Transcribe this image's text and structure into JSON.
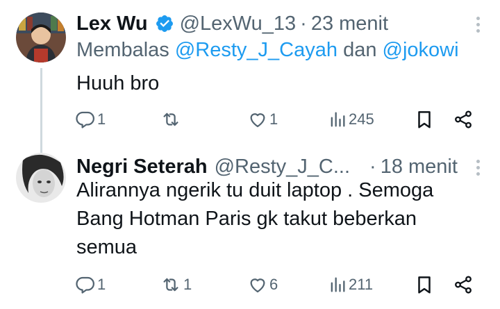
{
  "tweets": [
    {
      "name": "Lex Wu",
      "handle": "@LexWu_13",
      "time": "23 menit",
      "reply_prefix": "Membalas",
      "reply_user1": "@Resty_J_Cayah",
      "reply_joiner": "dan",
      "reply_user2": "@jokowi",
      "text": "Huuh bro",
      "replies": "1",
      "retweets": "",
      "likes": "1",
      "views": "245"
    },
    {
      "name": "Negri Seterah",
      "handle": "@Resty_J_C...",
      "time": "18 menit",
      "text": "Alirannya ngerik tu duit laptop  . Semoga Bang Hotman Paris  gk takut beberkan semua",
      "replies": "1",
      "retweets": "1",
      "likes": "6",
      "views": "211"
    }
  ],
  "icons": {
    "reply": "reply-icon",
    "retweet": "retweet-icon",
    "like": "heart-icon",
    "views": "views-icon",
    "bookmark": "bookmark-icon",
    "share": "share-icon",
    "verified": "verified-badge-icon",
    "more": "more-options-icon"
  },
  "colors": {
    "verified": "#1d9bf0",
    "mention": "#1d9bf0",
    "secondary_text": "#536471"
  }
}
